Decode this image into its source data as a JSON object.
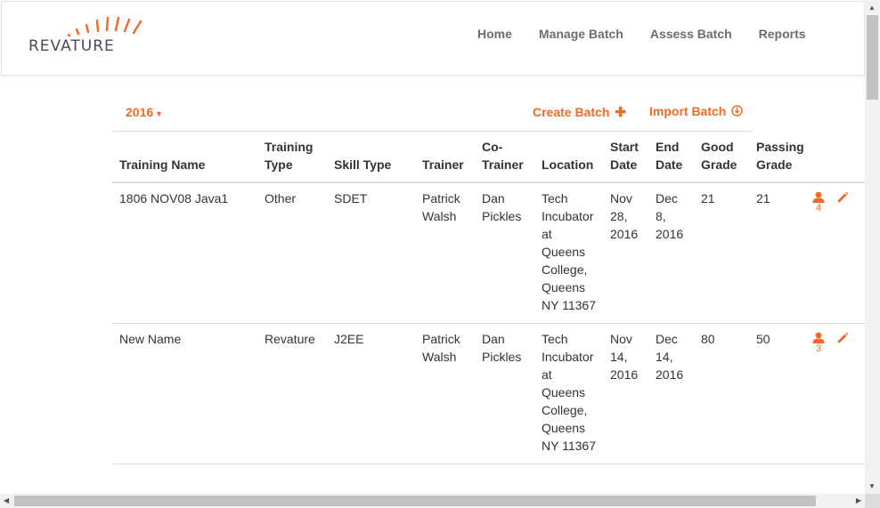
{
  "brand": {
    "name": "REVATURE",
    "accent": "#f26925"
  },
  "nav": {
    "items": [
      {
        "label": "Home"
      },
      {
        "label": "Manage Batch"
      },
      {
        "label": "Assess Batch"
      },
      {
        "label": "Reports"
      }
    ]
  },
  "toolbar": {
    "year": "2016",
    "create_label": "Create Batch",
    "import_label": "Import Batch",
    "create_icon": "plus-icon",
    "import_icon": "download-circle-icon"
  },
  "table": {
    "headers": [
      "Training Name",
      "Training Type",
      "Skill Type",
      "Trainer",
      "Co-Trainer",
      "Location",
      "Start Date",
      "End Date",
      "Good Grade",
      "Passing Grade"
    ],
    "rows": [
      {
        "name": "1806 NOV08 Java1",
        "type": "Other",
        "skill": "SDET",
        "trainer": "Patrick Walsh",
        "cotrainer": "Dan Pickles",
        "location": "Tech Incubator at Queens College, Queens NY 11367",
        "start": "Nov 28, 2016",
        "end": "Dec 8, 2016",
        "good": "21",
        "passing": "21",
        "trainees": "4"
      },
      {
        "name": "New Name",
        "type": "Revature",
        "skill": "J2EE",
        "trainer": "Patrick Walsh",
        "cotrainer": "Dan Pickles",
        "location": "Tech Incubator at Queens College, Queens NY 11367",
        "start": "Nov 14, 2016",
        "end": "Dec 14, 2016",
        "good": "80",
        "passing": "50",
        "trainees": "3"
      }
    ]
  }
}
